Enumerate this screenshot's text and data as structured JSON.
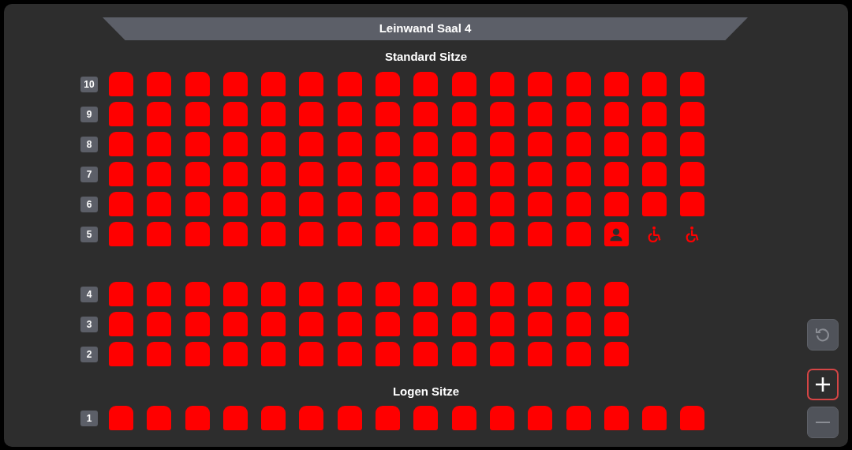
{
  "screen": {
    "title": "Leinwand Saal 4"
  },
  "sections": [
    {
      "title": "Standard Sitze",
      "blocks": [
        {
          "rows": [
            {
              "label": "10",
              "seats": [
                {
                  "kind": "seat"
                },
                {
                  "kind": "seat"
                },
                {
                  "kind": "seat"
                },
                {
                  "kind": "seat"
                },
                {
                  "kind": "seat"
                },
                {
                  "kind": "seat"
                },
                {
                  "kind": "seat"
                },
                {
                  "kind": "seat"
                },
                {
                  "kind": "seat"
                },
                {
                  "kind": "seat"
                },
                {
                  "kind": "seat"
                },
                {
                  "kind": "seat"
                },
                {
                  "kind": "seat"
                },
                {
                  "kind": "seat"
                },
                {
                  "kind": "seat"
                },
                {
                  "kind": "seat"
                }
              ]
            },
            {
              "label": "9",
              "seats": [
                {
                  "kind": "seat"
                },
                {
                  "kind": "seat"
                },
                {
                  "kind": "seat"
                },
                {
                  "kind": "seat"
                },
                {
                  "kind": "seat"
                },
                {
                  "kind": "seat"
                },
                {
                  "kind": "seat"
                },
                {
                  "kind": "seat"
                },
                {
                  "kind": "seat"
                },
                {
                  "kind": "seat"
                },
                {
                  "kind": "seat"
                },
                {
                  "kind": "seat"
                },
                {
                  "kind": "seat"
                },
                {
                  "kind": "seat"
                },
                {
                  "kind": "seat"
                },
                {
                  "kind": "seat"
                }
              ]
            },
            {
              "label": "8",
              "seats": [
                {
                  "kind": "seat"
                },
                {
                  "kind": "seat"
                },
                {
                  "kind": "seat"
                },
                {
                  "kind": "seat"
                },
                {
                  "kind": "seat"
                },
                {
                  "kind": "seat"
                },
                {
                  "kind": "seat"
                },
                {
                  "kind": "seat"
                },
                {
                  "kind": "seat"
                },
                {
                  "kind": "seat"
                },
                {
                  "kind": "seat"
                },
                {
                  "kind": "seat"
                },
                {
                  "kind": "seat"
                },
                {
                  "kind": "seat"
                },
                {
                  "kind": "seat"
                },
                {
                  "kind": "seat"
                }
              ]
            },
            {
              "label": "7",
              "seats": [
                {
                  "kind": "seat"
                },
                {
                  "kind": "seat"
                },
                {
                  "kind": "seat"
                },
                {
                  "kind": "seat"
                },
                {
                  "kind": "seat"
                },
                {
                  "kind": "seat"
                },
                {
                  "kind": "seat"
                },
                {
                  "kind": "seat"
                },
                {
                  "kind": "seat"
                },
                {
                  "kind": "seat"
                },
                {
                  "kind": "seat"
                },
                {
                  "kind": "seat"
                },
                {
                  "kind": "seat"
                },
                {
                  "kind": "seat"
                },
                {
                  "kind": "seat"
                },
                {
                  "kind": "seat"
                }
              ]
            },
            {
              "label": "6",
              "seats": [
                {
                  "kind": "seat"
                },
                {
                  "kind": "seat"
                },
                {
                  "kind": "seat"
                },
                {
                  "kind": "seat"
                },
                {
                  "kind": "seat"
                },
                {
                  "kind": "seat"
                },
                {
                  "kind": "seat"
                },
                {
                  "kind": "seat"
                },
                {
                  "kind": "seat"
                },
                {
                  "kind": "seat"
                },
                {
                  "kind": "seat"
                },
                {
                  "kind": "seat"
                },
                {
                  "kind": "seat"
                },
                {
                  "kind": "seat"
                },
                {
                  "kind": "seat"
                },
                {
                  "kind": "seat"
                }
              ]
            },
            {
              "label": "5",
              "seats": [
                {
                  "kind": "seat"
                },
                {
                  "kind": "seat"
                },
                {
                  "kind": "seat"
                },
                {
                  "kind": "seat"
                },
                {
                  "kind": "seat"
                },
                {
                  "kind": "seat"
                },
                {
                  "kind": "seat"
                },
                {
                  "kind": "seat"
                },
                {
                  "kind": "seat"
                },
                {
                  "kind": "seat"
                },
                {
                  "kind": "seat"
                },
                {
                  "kind": "seat"
                },
                {
                  "kind": "seat"
                },
                {
                  "kind": "person"
                },
                {
                  "kind": "wheelchair"
                },
                {
                  "kind": "wheelchair"
                }
              ]
            }
          ]
        },
        {
          "rows": [
            {
              "label": "4",
              "seats": [
                {
                  "kind": "seat"
                },
                {
                  "kind": "seat"
                },
                {
                  "kind": "seat"
                },
                {
                  "kind": "seat"
                },
                {
                  "kind": "seat"
                },
                {
                  "kind": "seat"
                },
                {
                  "kind": "seat"
                },
                {
                  "kind": "seat"
                },
                {
                  "kind": "seat"
                },
                {
                  "kind": "seat"
                },
                {
                  "kind": "seat"
                },
                {
                  "kind": "seat"
                },
                {
                  "kind": "seat"
                },
                {
                  "kind": "seat"
                }
              ]
            },
            {
              "label": "3",
              "seats": [
                {
                  "kind": "seat"
                },
                {
                  "kind": "seat"
                },
                {
                  "kind": "seat"
                },
                {
                  "kind": "seat"
                },
                {
                  "kind": "seat"
                },
                {
                  "kind": "seat"
                },
                {
                  "kind": "seat"
                },
                {
                  "kind": "seat"
                },
                {
                  "kind": "seat"
                },
                {
                  "kind": "seat"
                },
                {
                  "kind": "seat"
                },
                {
                  "kind": "seat"
                },
                {
                  "kind": "seat"
                },
                {
                  "kind": "seat"
                }
              ]
            },
            {
              "label": "2",
              "seats": [
                {
                  "kind": "seat"
                },
                {
                  "kind": "seat"
                },
                {
                  "kind": "seat"
                },
                {
                  "kind": "seat"
                },
                {
                  "kind": "seat"
                },
                {
                  "kind": "seat"
                },
                {
                  "kind": "seat"
                },
                {
                  "kind": "seat"
                },
                {
                  "kind": "seat"
                },
                {
                  "kind": "seat"
                },
                {
                  "kind": "seat"
                },
                {
                  "kind": "seat"
                },
                {
                  "kind": "seat"
                },
                {
                  "kind": "seat"
                }
              ]
            }
          ]
        }
      ]
    },
    {
      "title": "Logen Sitze",
      "blocks": [
        {
          "rows": [
            {
              "label": "1",
              "seats": [
                {
                  "kind": "seat"
                },
                {
                  "kind": "seat"
                },
                {
                  "kind": "seat"
                },
                {
                  "kind": "seat"
                },
                {
                  "kind": "seat"
                },
                {
                  "kind": "seat"
                },
                {
                  "kind": "seat"
                },
                {
                  "kind": "seat"
                },
                {
                  "kind": "seat"
                },
                {
                  "kind": "seat"
                },
                {
                  "kind": "seat"
                },
                {
                  "kind": "seat"
                },
                {
                  "kind": "seat"
                },
                {
                  "kind": "seat"
                },
                {
                  "kind": "seat"
                },
                {
                  "kind": "seat"
                }
              ]
            }
          ]
        }
      ]
    }
  ],
  "controls": [
    {
      "kind": "reset",
      "disabled": true,
      "focused": false
    },
    {
      "kind": "zoom_in",
      "disabled": false,
      "focused": true
    },
    {
      "kind": "zoom_out",
      "disabled": true,
      "focused": false
    }
  ]
}
